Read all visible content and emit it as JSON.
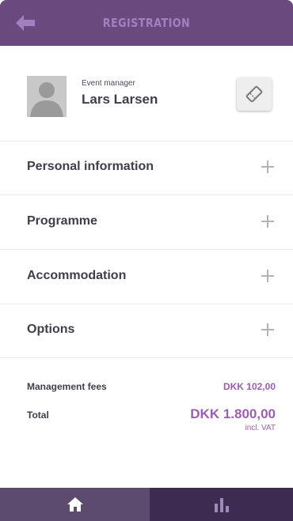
{
  "header": {
    "title": "REGISTRATION",
    "back_icon": "arrow-left-icon"
  },
  "profile": {
    "role": "Event manager",
    "name": "Lars Larsen",
    "ticket_icon": "ticket-icon"
  },
  "sections": [
    {
      "label": "Personal information"
    },
    {
      "label": "Programme"
    },
    {
      "label": "Accommodation"
    },
    {
      "label": "Options"
    }
  ],
  "summary": {
    "fees_label": "Management fees",
    "fees_value": "DKK 102,00",
    "total_label": "Total",
    "total_value": "DKK 1.800,00",
    "vat_note": "incl. VAT"
  },
  "nav": {
    "home_icon": "home-icon",
    "stats_icon": "bar-chart-icon"
  },
  "colors": {
    "header": "#6a4a7e",
    "accent": "#9c5eb0",
    "nav_home": "#5d4a6f",
    "nav_stats": "#3e2b52"
  }
}
